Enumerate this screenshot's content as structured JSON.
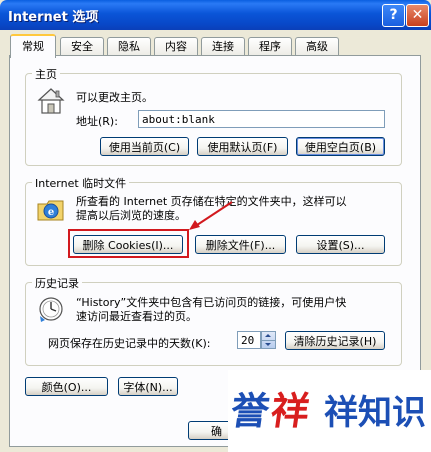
{
  "window": {
    "title": "Internet 选项",
    "help_glyph": "?",
    "close_glyph": "✕"
  },
  "tabs": [
    {
      "label": "常规",
      "active": true
    },
    {
      "label": "安全"
    },
    {
      "label": "隐私"
    },
    {
      "label": "内容"
    },
    {
      "label": "连接"
    },
    {
      "label": "程序"
    },
    {
      "label": "高级"
    }
  ],
  "home": {
    "group_label": "主页",
    "desc": "可以更改主页。",
    "address_label": "地址(R):",
    "address_value": "about:blank",
    "btn_current": "使用当前页(C)",
    "btn_default": "使用默认页(F)",
    "btn_blank": "使用空白页(B)"
  },
  "temp": {
    "group_label": "Internet 临时文件",
    "desc_line1": "所查看的 Internet 页存储在特定的文件夹中，这样可以",
    "desc_line2": "提高以后浏览的速度。",
    "btn_cookies": "删除 Cookies(I)...",
    "btn_files": "删除文件(F)...",
    "btn_settings": "设置(S)..."
  },
  "history": {
    "group_label": "历史记录",
    "desc_line1": "“History”文件夹中包含有已访问页的链接，可使用户快",
    "desc_line2": "速访问最近查看过的页。",
    "days_label": "网页保存在历史记录中的天数(K):",
    "days_value": "20",
    "btn_clear": "清除历史记录(H)"
  },
  "bottom": {
    "btn_colors": "颜色(O)...",
    "btn_fonts": "字体(N)...",
    "btn_ok_partial": "确"
  },
  "watermark": {
    "text": "誉祥祥知识"
  },
  "colors": {
    "highlight": "#d2191e",
    "watermark_blue": "#1c4fb5",
    "watermark_red": "#d81e1e"
  }
}
